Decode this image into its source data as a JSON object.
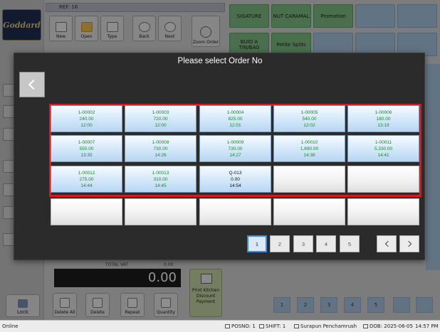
{
  "app": {
    "logo_text": "Goddard",
    "ref_label": "REF: 16",
    "toolbar": {
      "new_label": "New",
      "open_label": "Open",
      "type_label": "Type",
      "back_label": "Back",
      "next_label": "Next",
      "zoom_label": "Zoom Order"
    },
    "menu": {
      "tile1": "SIGATURE",
      "tile2": "NUT CARAMAL",
      "tile3": "Promotion",
      "tile4": "BUID A TIN/BAG",
      "tile5": "Petite Splits"
    },
    "total_vat_label": "TOTAL VAT",
    "total_vat_value": "0.00",
    "total_display": "0.00",
    "print_kitchen_label": "Print Kitchen Discount Payment",
    "lock_label": "Lock",
    "bottom_actions": {
      "delete_all": "Delete All",
      "delete": "Delete",
      "repeat": "Repeat",
      "quantity": "Quantity"
    },
    "bg_pager": [
      "1",
      "2",
      "3",
      "4",
      "5"
    ]
  },
  "status_bar": {
    "state": "Online",
    "posno": "POSNO: 1",
    "shift": "SHIFT: 1",
    "user": "Surapun Penchamrush",
    "dob": "DOB: 2025-06-05",
    "time": "14:57 PM"
  },
  "modal": {
    "title": "Please select Order No",
    "orders": [
      {
        "no": "1-00002",
        "amount": "240.00",
        "time": "12:00"
      },
      {
        "no": "1-00003",
        "amount": "720.00",
        "time": "12:00"
      },
      {
        "no": "1-00004",
        "amount": "825.00",
        "time": "12:01"
      },
      {
        "no": "1-00005",
        "amount": "540.00",
        "time": "12:02"
      },
      {
        "no": "1-00006",
        "amount": "180.00",
        "time": "13:19"
      },
      {
        "no": "1-00007",
        "amount": "550.00",
        "time": "13:35"
      },
      {
        "no": "1-00008",
        "amount": "730.00",
        "time": "14:26"
      },
      {
        "no": "1-00009",
        "amount": "730.00",
        "time": "14:27"
      },
      {
        "no": "1-00010",
        "amount": "1,690.00",
        "time": "14:38"
      },
      {
        "no": "1-00011",
        "amount": "5,330.00",
        "time": "14:41"
      },
      {
        "no": "1-00012",
        "amount": "275.00",
        "time": "14:44"
      },
      {
        "no": "1-00013",
        "amount": "310.00",
        "time": "14:45"
      },
      {
        "no": "Q-013",
        "amount": "0.00",
        "time": "14:54"
      }
    ],
    "pages": [
      "1",
      "2",
      "3",
      "4",
      "5"
    ],
    "active_page": "1",
    "colors": {
      "order_text": "#1a8a2a",
      "highlight_border": "#e3141b",
      "active_page_border": "#3d8be0"
    }
  }
}
